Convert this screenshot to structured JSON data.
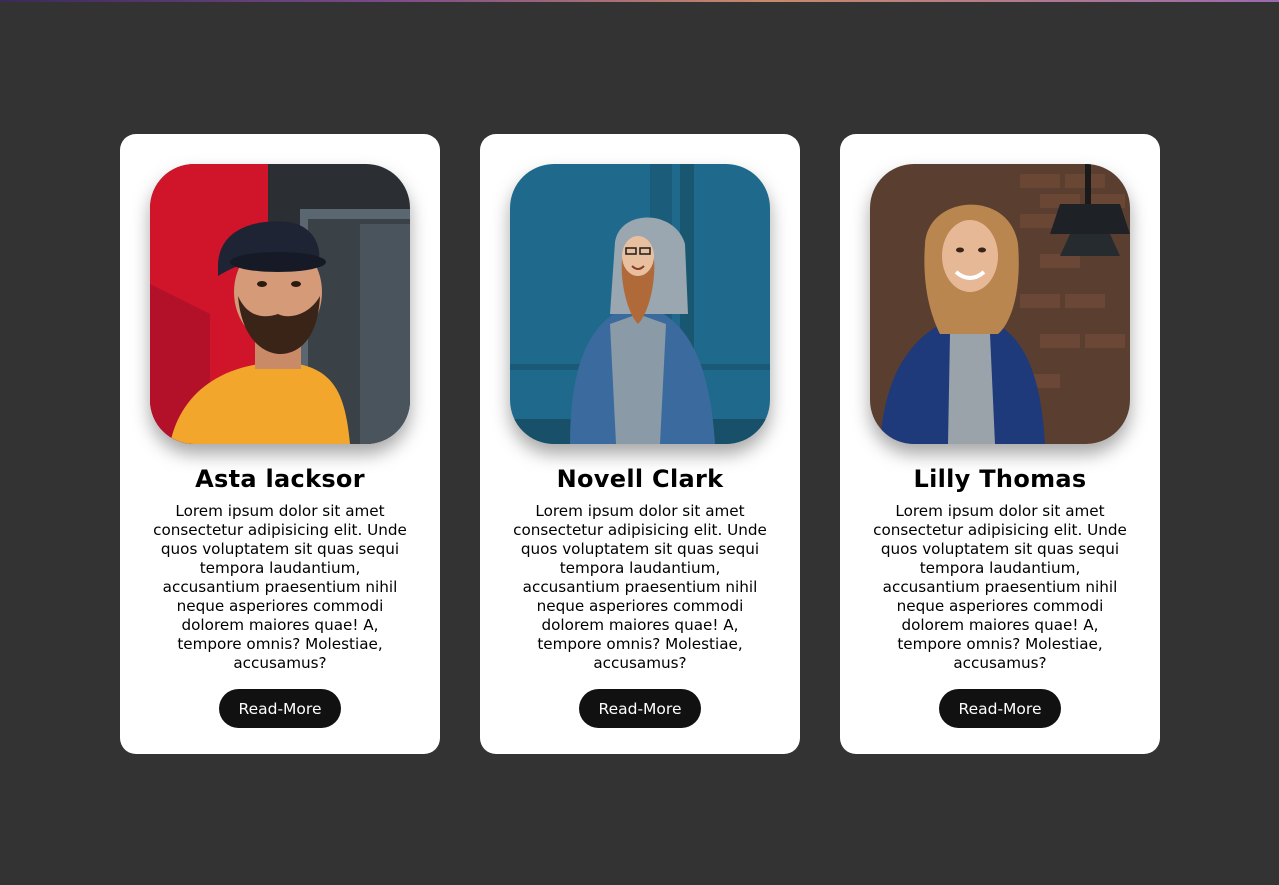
{
  "cards": [
    {
      "name": "Asta lacksor",
      "description": "Lorem ipsum dolor sit amet consectetur adipisicing elit. Unde quos voluptatem sit quas sequi tempora laudantium, accusantium praesentium nihil neque asperiores commodi dolorem maiores quae! A, tempore omnis? Molestiae, accusamus?",
      "button_label": "Read-More",
      "photo_icon": "man-in-cap-yellow-shirt-photo"
    },
    {
      "name": "Novell Clark",
      "description": "Lorem ipsum dolor sit amet consectetur adipisicing elit. Unde quos voluptatem sit quas sequi tempora laudantium, accusantium praesentium nihil neque asperiores commodi dolorem maiores quae! A, tempore omnis? Molestiae, accusamus?",
      "button_label": "Read-More",
      "photo_icon": "woman-in-hoodie-denim-jacket-photo"
    },
    {
      "name": "Lilly Thomas",
      "description": "Lorem ipsum dolor sit amet consectetur adipisicing elit. Unde quos voluptatem sit quas sequi tempora laudantium, accusantium praesentium nihil neque asperiores commodi dolorem maiores quae! A, tempore omnis? Molestiae, accusamus?",
      "button_label": "Read-More",
      "photo_icon": "smiling-woman-brick-wall-photo"
    }
  ],
  "colors": {
    "background": "#333333",
    "card": "#ffffff",
    "button": "#111111",
    "button_text": "#ffffff"
  }
}
